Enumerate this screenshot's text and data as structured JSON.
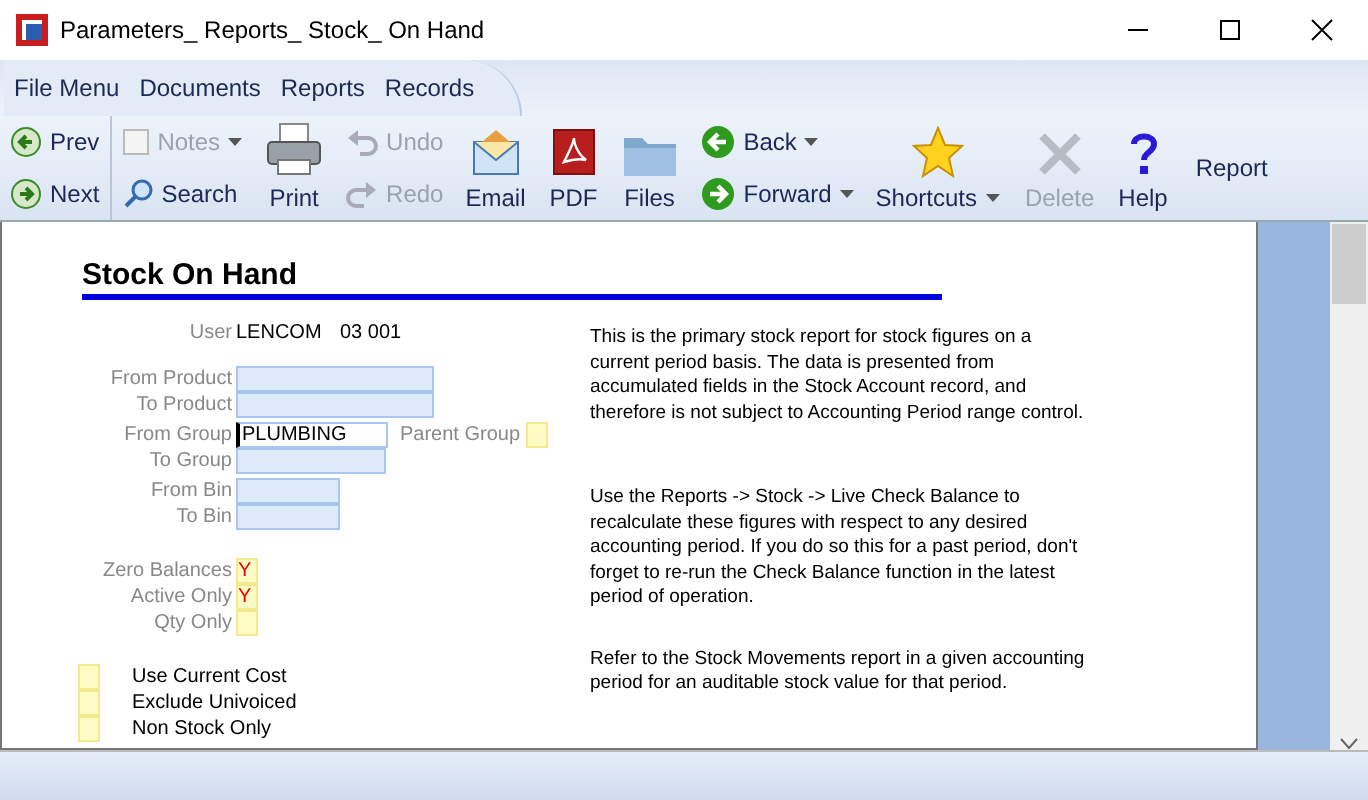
{
  "window": {
    "title": "Parameters_ Reports_ Stock_ On Hand"
  },
  "menu": [
    "File Menu",
    "Documents",
    "Reports",
    "Records"
  ],
  "toolbar": [
    {
      "kind": "pair",
      "items": [
        {
          "label": "Prev",
          "disabled": false,
          "dropdown": false
        },
        {
          "label": "Next",
          "disabled": false,
          "dropdown": false
        }
      ]
    },
    {
      "kind": "pair",
      "items": [
        {
          "label": "Notes",
          "disabled": true,
          "dropdown": true
        },
        {
          "label": "Search",
          "disabled": false,
          "dropdown": false
        }
      ]
    },
    {
      "kind": "big",
      "label": "Print",
      "disabled": false,
      "dropdown": false
    },
    {
      "kind": "pair",
      "items": [
        {
          "label": "Undo",
          "disabled": true,
          "dropdown": false
        },
        {
          "label": "Redo",
          "disabled": true,
          "dropdown": false
        }
      ]
    },
    {
      "kind": "big",
      "label": "Email",
      "disabled": false,
      "dropdown": false
    },
    {
      "kind": "big",
      "label": "PDF",
      "disabled": false,
      "dropdown": false
    },
    {
      "kind": "big",
      "label": "Files",
      "disabled": false,
      "dropdown": false
    },
    {
      "kind": "pair",
      "items": [
        {
          "label": "Back",
          "disabled": false,
          "dropdown": true
        },
        {
          "label": "Forward",
          "disabled": false,
          "dropdown": true
        }
      ]
    },
    {
      "kind": "big",
      "label": "Shortcuts",
      "disabled": false,
      "dropdown": true
    },
    {
      "kind": "big",
      "label": "Delete",
      "disabled": true,
      "dropdown": false
    },
    {
      "kind": "big",
      "label": "Help",
      "disabled": false,
      "dropdown": false
    },
    {
      "kind": "text",
      "label": "Report",
      "disabled": false,
      "dropdown": false
    }
  ],
  "report": {
    "title": "Stock On Hand",
    "user": {
      "label": "User",
      "name": "LENCOM",
      "code": "03 001"
    },
    "fields": [
      {
        "label": "From Product",
        "focused": false
      },
      {
        "label": "To Product",
        "focused": false
      },
      {
        "label": "From Group",
        "value": "PLUMBING",
        "focused": true,
        "extra": {
          "label": "Parent Group"
        }
      },
      {
        "label": "To Group",
        "focused": false
      },
      {
        "label": "From Bin",
        "focused": false
      },
      {
        "label": "To Bin",
        "focused": false
      }
    ],
    "flags": [
      {
        "label": "Zero Balances",
        "value": "Y"
      },
      {
        "label": "Active Only",
        "value": "Y"
      },
      {
        "label": "Qty Only"
      }
    ],
    "options": [
      {
        "label": "Use Current Cost",
        "checked": false
      },
      {
        "label": "Exclude Univoiced",
        "checked": false
      },
      {
        "label": "Non Stock Only",
        "checked": false
      }
    ],
    "notes": [
      "This is the primary stock report for stock figures on a current period basis. The data is presented from accumulated fields in the Stock Account record, and therefore is not subject to Accounting Period range control.",
      "Use the Reports -> Stock -> Live Check Balance to recalculate these figures with respect to any desired accounting period. If you do so this for a past period, don't forget to re-run the Check Balance function in the latest period of operation.",
      "Refer to the Stock Movements report in a given accounting period for an auditable stock value for that period."
    ]
  }
}
